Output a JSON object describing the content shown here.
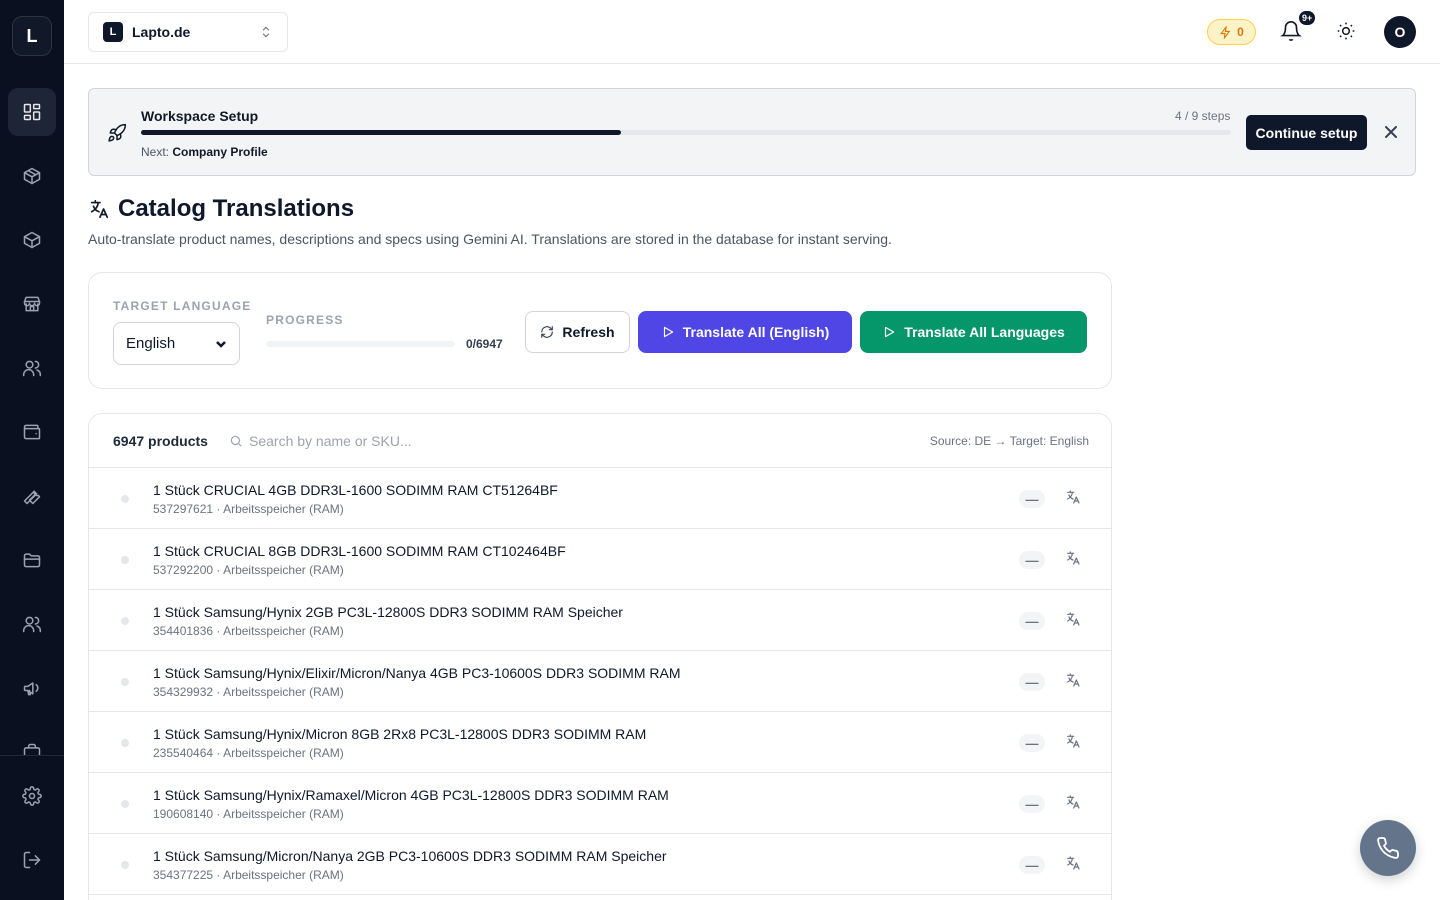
{
  "sidebar": {
    "logo_letter": "L",
    "items": [
      {
        "icon": "dashboard-icon",
        "active": true
      },
      {
        "icon": "box-icon",
        "active": false
      },
      {
        "icon": "package-icon",
        "active": false
      },
      {
        "icon": "store-icon",
        "active": false
      },
      {
        "icon": "users-icon",
        "active": false
      },
      {
        "icon": "wallet-icon",
        "active": false
      },
      {
        "icon": "wrench-icon",
        "active": false
      },
      {
        "icon": "folder-icon",
        "active": false
      },
      {
        "icon": "team-icon",
        "active": false
      },
      {
        "icon": "megaphone-icon",
        "active": false
      },
      {
        "icon": "settings-icon",
        "active": false
      },
      {
        "icon": "logout-icon",
        "active": false
      }
    ]
  },
  "topbar": {
    "workspace_badge": "L",
    "workspace_name": "Lapto.de",
    "credits": "0",
    "notifications_badge": "9+",
    "avatar_letter": "O"
  },
  "setup": {
    "title": "Workspace Setup",
    "steps": "4 / 9 steps",
    "progress": 0.44,
    "next_label": "Next:",
    "next_value": "Company Profile",
    "button": "Continue setup"
  },
  "page": {
    "title": "Catalog Translations",
    "subtitle": "Auto-translate product names, descriptions and specs using Gemini AI. Translations are stored in the database for instant serving."
  },
  "controls": {
    "target_language_label": "TARGET LANGUAGE",
    "target_language": "English",
    "progress_label": "PROGRESS",
    "progress_value": "0/6947",
    "progress_fraction": 0,
    "refresh": "Refresh",
    "translate_current": "Translate All (English)",
    "translate_all": "Translate All Languages"
  },
  "list": {
    "count": "6947 products",
    "search_placeholder": "Search by name or SKU...",
    "source_target": "Source: DE → Target: English",
    "status_symbol": "—",
    "rows": [
      {
        "name": "1 Stück CRUCIAL 4GB DDR3L-1600 SODIMM RAM CT51264BF",
        "meta": "537297621 · Arbeitsspeicher (RAM)"
      },
      {
        "name": "1 Stück CRUCIAL 8GB DDR3L-1600 SODIMM RAM CT102464BF",
        "meta": "537292200 · Arbeitsspeicher (RAM)"
      },
      {
        "name": "1 Stück Samsung/Hynix 2GB PC3L-12800S DDR3 SODIMM RAM Speicher",
        "meta": "354401836 · Arbeitsspeicher (RAM)"
      },
      {
        "name": "1 Stück Samsung/Hynix/Elixir/Micron/Nanya 4GB PC3-10600S DDR3 SODIMM RAM",
        "meta": "354329932 · Arbeitsspeicher (RAM)"
      },
      {
        "name": "1 Stück Samsung/Hynix/Micron 8GB 2Rx8 PC3L-12800S DDR3 SODIMM RAM",
        "meta": "235540464 · Arbeitsspeicher (RAM)"
      },
      {
        "name": "1 Stück Samsung/Hynix/Ramaxel/Micron 4GB PC3L-12800S DDR3 SODIMM RAM",
        "meta": "190608140 · Arbeitsspeicher (RAM)"
      },
      {
        "name": "1 Stück Samsung/Micron/Nanya 2GB PC3-10600S DDR3 SODIMM RAM Speicher",
        "meta": "354377225 · Arbeitsspeicher (RAM)"
      }
    ]
  },
  "colors": {
    "sidebar_bg": "#0b1020",
    "primary": "#4f46e5",
    "success": "#059669",
    "dark": "#0f172a"
  }
}
